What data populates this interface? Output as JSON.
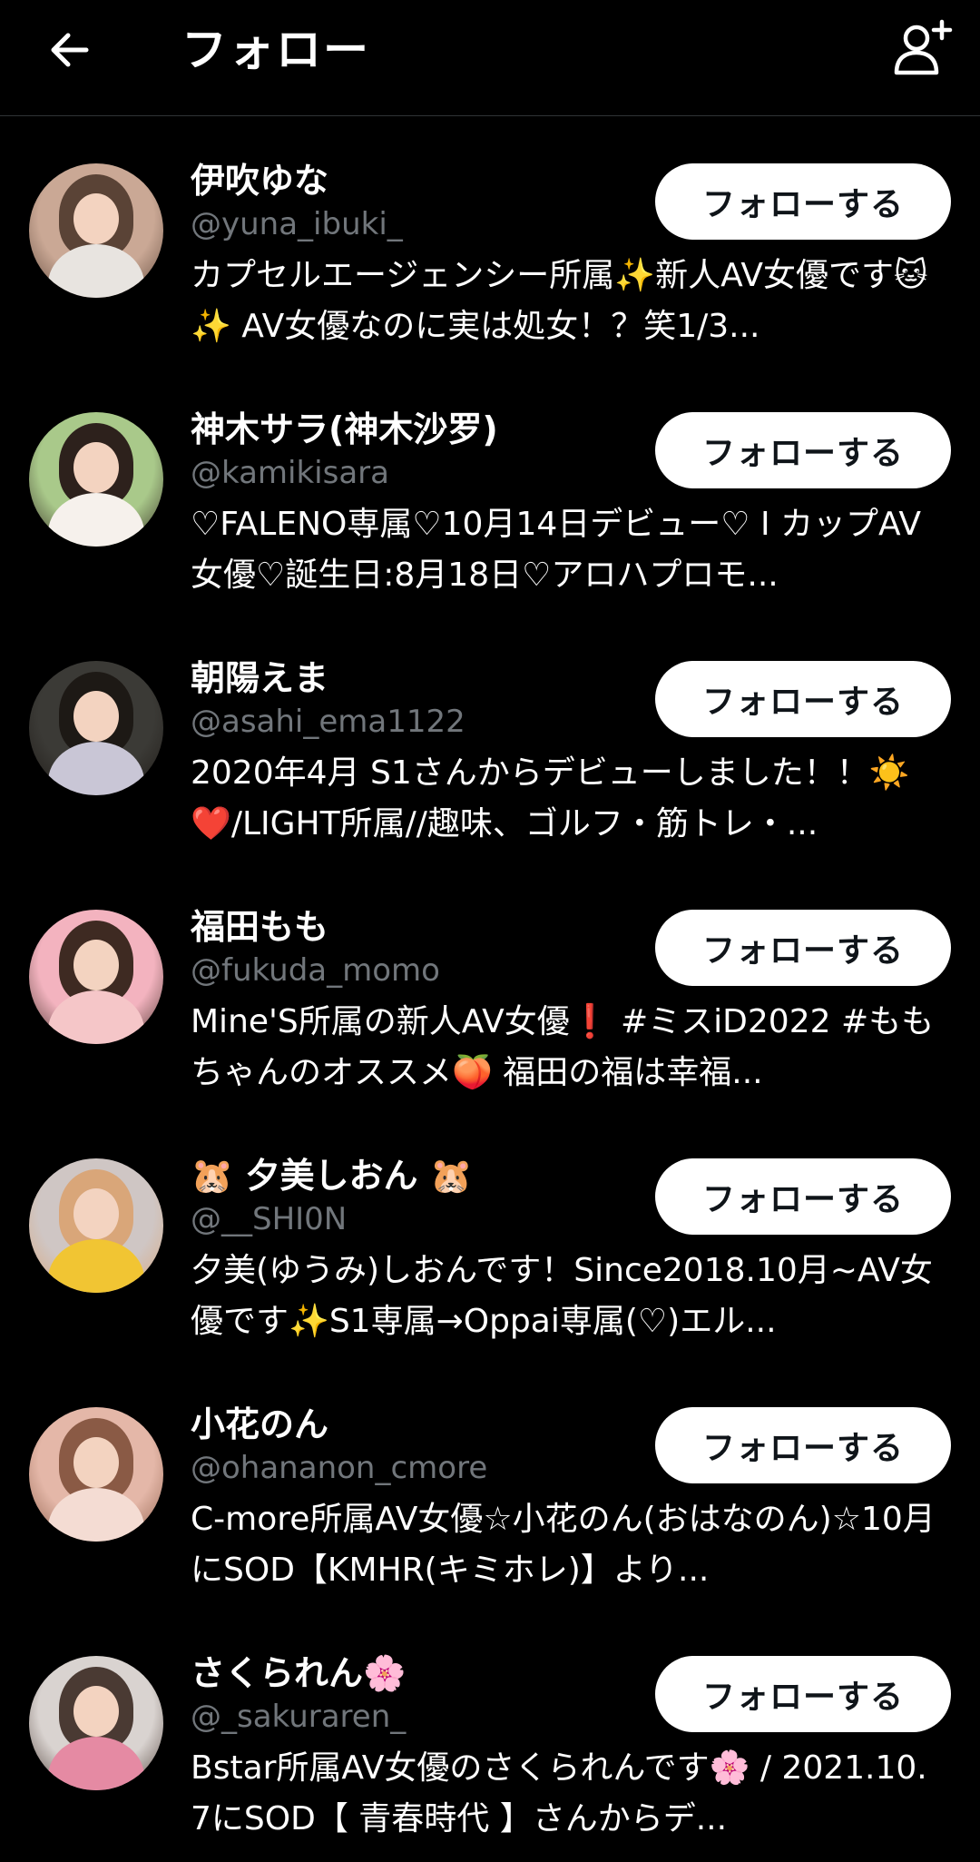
{
  "header": {
    "title": "フォロー"
  },
  "follow_label": "フォローする",
  "users": [
    {
      "name": "伊吹ゆな",
      "handle": "@yuna_ibuki_",
      "bio": "カプセルエージェンシー所属✨新人AV女優です🐱✨ AV女優なのに実は処女！？笑1/3...",
      "avatar_colors": [
        "#caa895",
        "#5a4336",
        "#e8e4e0"
      ]
    },
    {
      "name": "神木サラ(神木沙罗)",
      "handle": "@kamikisara",
      "bio": "♡FALENO専属♡10月14日デビュー♡ I カップAV女優♡誕生日:8月18日♡アロハプロモ...",
      "avatar_colors": [
        "#a9c98a",
        "#2d211c",
        "#f6f1ec"
      ]
    },
    {
      "name": "朝陽えま",
      "handle": "@asahi_ema1122",
      "bio": "2020年4月 S1さんからデビューしました！！☀️❤️/LIGHT所属//趣味、ゴルフ・筋トレ・...",
      "avatar_colors": [
        "#3b3a36",
        "#1d1915",
        "#c9c6d6"
      ]
    },
    {
      "name": "福田もも",
      "handle": "@fukuda_momo",
      "bio": "Mine'S所属の新人AV女優❗ #ミスiD2022 #ももちゃんのオススメ🍑 福田の福は幸福...",
      "avatar_colors": [
        "#f3b3bf",
        "#3e2a22",
        "#f5c6c8"
      ]
    },
    {
      "name": "🐹 夕美しおん 🐹",
      "handle": "@__SHI0N",
      "bio": "夕美(ゆうみ)しおんです！Since2018.10月~AV女優です✨S1専属→Oppai専属(♡)エル...",
      "avatar_colors": [
        "#cfc6c4",
        "#d9a679",
        "#f1c533"
      ]
    },
    {
      "name": "小花のん",
      "handle": "@ohananon_cmore",
      "bio": "C-more所属AV女優☆小花のん(おはなのん)☆10月にSOD【KMHR(キミホレ)】より...",
      "avatar_colors": [
        "#e4b7a8",
        "#8a5a45",
        "#f4dcd3"
      ]
    },
    {
      "name": "さくられん🌸",
      "handle": "@_sakuraren_",
      "bio": "Bstar所属AV女優のさくられんです🌸 / 2021.10.7にSOD【 青春時代 】さんからデ...",
      "avatar_colors": [
        "#d9d3d0",
        "#4a3a33",
        "#e58aa3"
      ]
    }
  ]
}
